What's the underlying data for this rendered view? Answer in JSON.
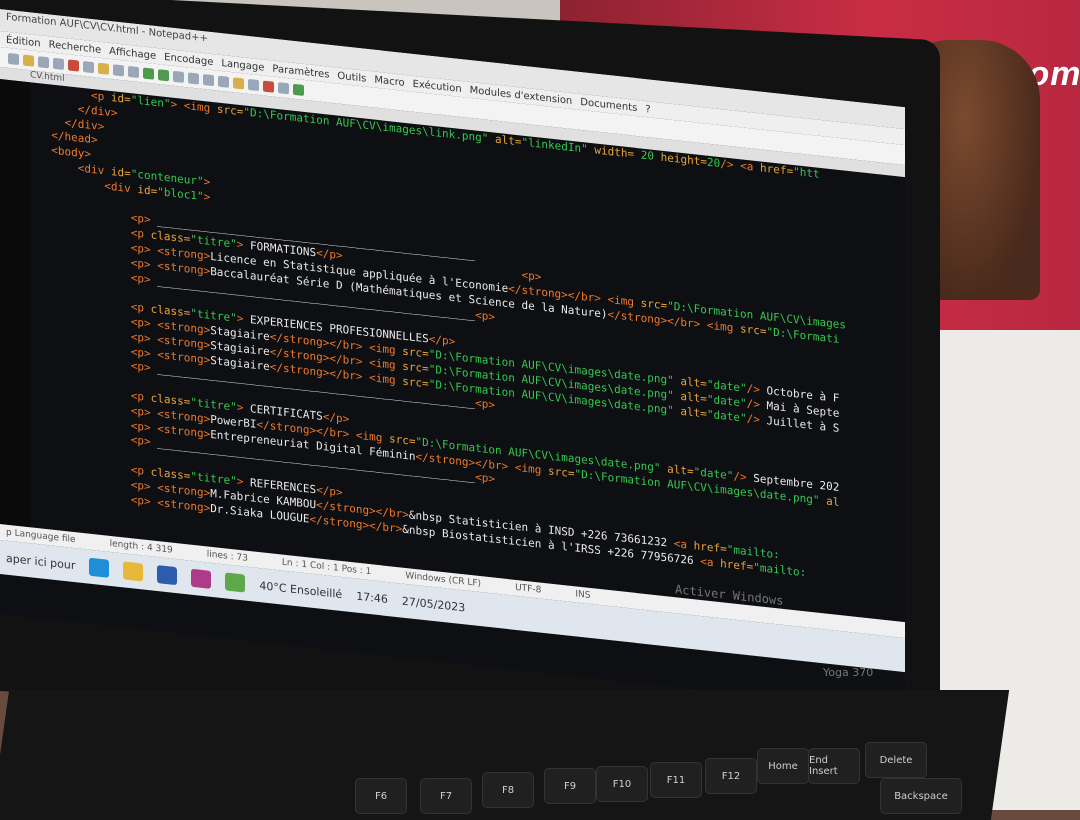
{
  "window": {
    "title": "Formation AUF\\CV\\CV.html - Notepad++"
  },
  "menu": [
    "Édition",
    "Recherche",
    "Affichage",
    "Encodage",
    "Langage",
    "Paramètres",
    "Outils",
    "Macro",
    "Exécution",
    "Modules d'extension",
    "Documents",
    "?"
  ],
  "tab": {
    "label": "CV.html"
  },
  "code_lines": [
    [
      [
        "tag",
        "        <p "
      ],
      [
        "attr",
        "id="
      ],
      [
        "str",
        "\"lien\""
      ],
      [
        "tag",
        "> <img "
      ],
      [
        "attr",
        "src="
      ],
      [
        "str",
        "\"D:\\Formation AUF\\CV\\images\\link.png\" "
      ],
      [
        "attr",
        "alt="
      ],
      [
        "str",
        "\"linkedIn\" "
      ],
      [
        "attr",
        "width="
      ],
      [
        "str",
        " 20 "
      ],
      [
        "attr",
        "height="
      ],
      [
        "str",
        "20"
      ],
      [
        "tag",
        "/> <a "
      ],
      [
        "attr",
        "href="
      ],
      [
        "str",
        "\"htt"
      ]
    ],
    [
      [
        "tag",
        "      </div>"
      ]
    ],
    [
      [
        "tag",
        "    </div>"
      ]
    ],
    [
      [
        "tag",
        "  </head>"
      ]
    ],
    [
      [
        "tag",
        "  <body>"
      ]
    ],
    [
      [
        "tag",
        "      <div "
      ],
      [
        "attr",
        "id="
      ],
      [
        "str",
        "\"conteneur\""
      ],
      [
        "tag",
        ">"
      ]
    ],
    [
      [
        "tag",
        "          <div "
      ],
      [
        "attr",
        "id="
      ],
      [
        "str",
        "\"bloc1\""
      ],
      [
        "tag",
        ">"
      ]
    ],
    [
      [
        "txt",
        " "
      ]
    ],
    [
      [
        "tag",
        "              <p>"
      ],
      [
        "txt",
        " ________________________________________________"
      ]
    ],
    [
      [
        "tag",
        "              <p "
      ],
      [
        "attr",
        "class="
      ],
      [
        "str",
        "\"titre\""
      ],
      [
        "tag",
        ">"
      ],
      [
        "txt",
        " FORMATIONS"
      ],
      [
        "tag",
        "</p>"
      ],
      [
        "txt",
        "                           "
      ],
      [
        "tag",
        "<p>"
      ]
    ],
    [
      [
        "tag",
        "              <p> <strong>"
      ],
      [
        "txt",
        "Licence en Statistique appliquée à l'Economie"
      ],
      [
        "tag",
        "</strong></br> <img "
      ],
      [
        "attr",
        "src="
      ],
      [
        "str",
        "\"D:\\Formation AUF\\CV\\images"
      ]
    ],
    [
      [
        "tag",
        "              <p> <strong>"
      ],
      [
        "txt",
        "Baccalauréat Série D (Mathématiques et Science de la Nature)"
      ],
      [
        "tag",
        "</strong></br> <img "
      ],
      [
        "attr",
        "src="
      ],
      [
        "str",
        "\"D:\\Formati"
      ]
    ],
    [
      [
        "tag",
        "              <p>"
      ],
      [
        "txt",
        " ________________________________________________"
      ],
      [
        "tag",
        "<p>"
      ]
    ],
    [
      [
        "txt",
        " "
      ]
    ],
    [
      [
        "tag",
        "              <p "
      ],
      [
        "attr",
        "class="
      ],
      [
        "str",
        "\"titre\""
      ],
      [
        "tag",
        ">"
      ],
      [
        "txt",
        " EXPERIENCES PROFESIONNELLES"
      ],
      [
        "tag",
        "</p>"
      ]
    ],
    [
      [
        "tag",
        "              <p> <strong>"
      ],
      [
        "txt",
        "Stagiaire"
      ],
      [
        "tag",
        "</strong></br> <img "
      ],
      [
        "attr",
        "src="
      ],
      [
        "str",
        "\"D:\\Formation AUF\\CV\\images\\date.png\" "
      ],
      [
        "attr",
        "alt="
      ],
      [
        "str",
        "\"date\""
      ],
      [
        "tag",
        "/>"
      ],
      [
        "txt",
        " Octobre à F"
      ]
    ],
    [
      [
        "tag",
        "              <p> <strong>"
      ],
      [
        "txt",
        "Stagiaire"
      ],
      [
        "tag",
        "</strong></br> <img "
      ],
      [
        "attr",
        "src="
      ],
      [
        "str",
        "\"D:\\Formation AUF\\CV\\images\\date.png\" "
      ],
      [
        "attr",
        "alt="
      ],
      [
        "str",
        "\"date\""
      ],
      [
        "tag",
        "/>"
      ],
      [
        "txt",
        " Mai à Septe"
      ]
    ],
    [
      [
        "tag",
        "              <p> <strong>"
      ],
      [
        "txt",
        "Stagiaire"
      ],
      [
        "tag",
        "</strong></br> <img "
      ],
      [
        "attr",
        "src="
      ],
      [
        "str",
        "\"D:\\Formation AUF\\CV\\images\\date.png\" "
      ],
      [
        "attr",
        "alt="
      ],
      [
        "str",
        "\"date\""
      ],
      [
        "tag",
        "/>"
      ],
      [
        "txt",
        " Juillet à S"
      ]
    ],
    [
      [
        "tag",
        "              <p>"
      ],
      [
        "txt",
        " ________________________________________________"
      ],
      [
        "tag",
        "<p>"
      ]
    ],
    [
      [
        "txt",
        " "
      ]
    ],
    [
      [
        "tag",
        "              <p "
      ],
      [
        "attr",
        "class="
      ],
      [
        "str",
        "\"titre\""
      ],
      [
        "tag",
        ">"
      ],
      [
        "txt",
        " CERTIFICATS"
      ],
      [
        "tag",
        "</p>"
      ]
    ],
    [
      [
        "tag",
        "              <p> <strong>"
      ],
      [
        "txt",
        "PowerBI"
      ],
      [
        "tag",
        "</strong></br> <img "
      ],
      [
        "attr",
        "src="
      ],
      [
        "str",
        "\"D:\\Formation AUF\\CV\\images\\date.png\" "
      ],
      [
        "attr",
        "alt="
      ],
      [
        "str",
        "\"date\""
      ],
      [
        "tag",
        "/>"
      ],
      [
        "txt",
        " Septembre 202"
      ]
    ],
    [
      [
        "tag",
        "              <p> <strong>"
      ],
      [
        "txt",
        "Entrepreneuriat Digital Féminin"
      ],
      [
        "tag",
        "</strong></br> <img "
      ],
      [
        "attr",
        "src="
      ],
      [
        "str",
        "\"D:\\Formation AUF\\CV\\images\\date.png\" "
      ],
      [
        "attr",
        "al"
      ]
    ],
    [
      [
        "tag",
        "              <p>"
      ],
      [
        "txt",
        " ________________________________________________"
      ],
      [
        "tag",
        "<p>"
      ]
    ],
    [
      [
        "txt",
        " "
      ]
    ],
    [
      [
        "tag",
        "              <p "
      ],
      [
        "attr",
        "class="
      ],
      [
        "str",
        "\"titre\""
      ],
      [
        "tag",
        ">"
      ],
      [
        "txt",
        " REFERENCES"
      ],
      [
        "tag",
        "</p>"
      ]
    ],
    [
      [
        "tag",
        "              <p> <strong>"
      ],
      [
        "txt",
        "M.Fabrice KAMBOU"
      ],
      [
        "tag",
        "</strong></br>"
      ],
      [
        "txt",
        "&nbsp Statisticien à INSD +226 73661232 "
      ],
      [
        "tag",
        "<a "
      ],
      [
        "attr",
        "href="
      ],
      [
        "str",
        "\"mailto:"
      ]
    ],
    [
      [
        "tag",
        "              <p> <strong>"
      ],
      [
        "txt",
        "Dr.Siaka LOUGUE"
      ],
      [
        "tag",
        "</strong></br>"
      ],
      [
        "txt",
        "&nbsp Biostatisticien à l'IRSS +226 77956726 "
      ],
      [
        "tag",
        "<a "
      ],
      [
        "attr",
        "href="
      ],
      [
        "str",
        "\"mailto:"
      ]
    ]
  ],
  "watermark": "Activer Windows",
  "status": {
    "lang": "p Language file",
    "length": "length : 4 319",
    "lines": "lines : 73",
    "pos": "Ln : 1   Col : 1   Pos : 1",
    "eol": "Windows (CR LF)",
    "enc": "UTF-8",
    "ins": "INS"
  },
  "taskbar": {
    "search": "aper ici pour",
    "weather": "40°C Ensoleillé",
    "time": "17:46",
    "date": "27/05/2023"
  },
  "laptop": {
    "brand": "Yoga 370"
  },
  "background": {
    "sign": "Thom"
  },
  "keys": [
    {
      "id": "k-f6",
      "label": "F6"
    },
    {
      "id": "k-f7",
      "label": "F7"
    },
    {
      "id": "k-f8",
      "label": "F8"
    },
    {
      "id": "k-f9",
      "label": "F9"
    },
    {
      "id": "k-f10",
      "label": "F10"
    },
    {
      "id": "k-f11",
      "label": "F11"
    },
    {
      "id": "k-f12",
      "label": "F12"
    },
    {
      "id": "k-home",
      "label": "Home"
    },
    {
      "id": "k-end",
      "label": "End Insert"
    },
    {
      "id": "k-delete",
      "label": "Delete"
    },
    {
      "id": "k-backspace",
      "label": "Backspace"
    }
  ]
}
